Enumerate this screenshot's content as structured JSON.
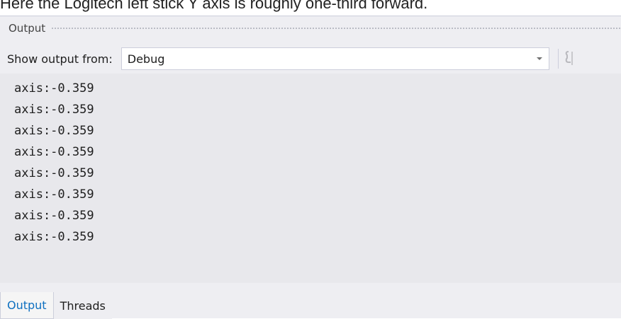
{
  "caption": "Here the Logitech left stick Y axis is roughly one-third forward.",
  "panel": {
    "title": "Output",
    "show_output_label": "Show output from:",
    "source_selected": "Debug"
  },
  "output": {
    "lines": [
      "axis:-0.359",
      "axis:-0.359",
      "axis:-0.359",
      "axis:-0.359",
      "axis:-0.359",
      "axis:-0.359",
      "axis:-0.359",
      "axis:-0.359"
    ]
  },
  "tabs": [
    {
      "label": "Output",
      "active": true
    },
    {
      "label": "Threads",
      "active": false
    }
  ],
  "colors": {
    "accent": "#0e70c0",
    "panel_bg": "#eeeef2",
    "output_bg": "#e8e8ec"
  },
  "icons": {
    "dropdown": "chevron-down-icon",
    "toolbar_action": "find-message-icon"
  }
}
